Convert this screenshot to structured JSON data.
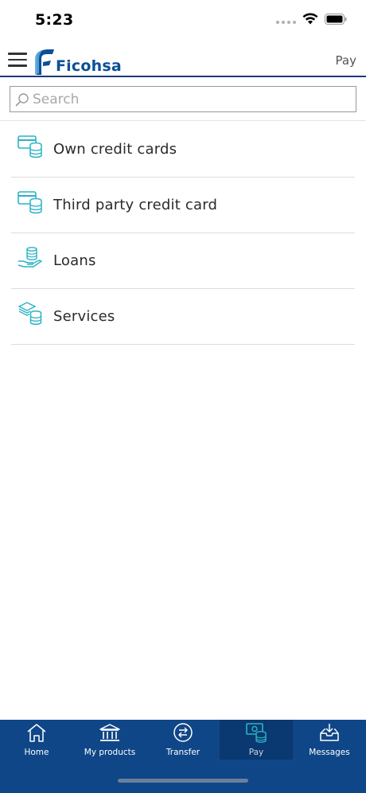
{
  "status_bar": {
    "time": "5:23"
  },
  "header": {
    "logo_text": "Ficohsa",
    "title": "Pay"
  },
  "search": {
    "placeholder": "Search",
    "value": ""
  },
  "pay_options": [
    {
      "label": "Own credit cards",
      "icon": "credit-card-coins-icon"
    },
    {
      "label": "Third party credit card",
      "icon": "credit-card-coins-icon"
    },
    {
      "label": "Loans",
      "icon": "hand-coins-icon"
    },
    {
      "label": "Services",
      "icon": "bills-coins-icon"
    }
  ],
  "tab_bar": {
    "tabs": [
      {
        "label": "Home",
        "icon": "home-icon",
        "active": false
      },
      {
        "label": "My products",
        "icon": "bank-icon",
        "active": false
      },
      {
        "label": "Transfer",
        "icon": "transfer-icon",
        "active": false
      },
      {
        "label": "Pay",
        "icon": "pay-icon",
        "active": true
      },
      {
        "label": "Messages",
        "icon": "inbox-icon",
        "active": false
      }
    ]
  },
  "colors": {
    "brand_blue": "#0c4f97",
    "tab_bar_bg": "#0f4687",
    "tab_active_bg": "#0a3870",
    "icon_teal": "#2bb3c4"
  }
}
